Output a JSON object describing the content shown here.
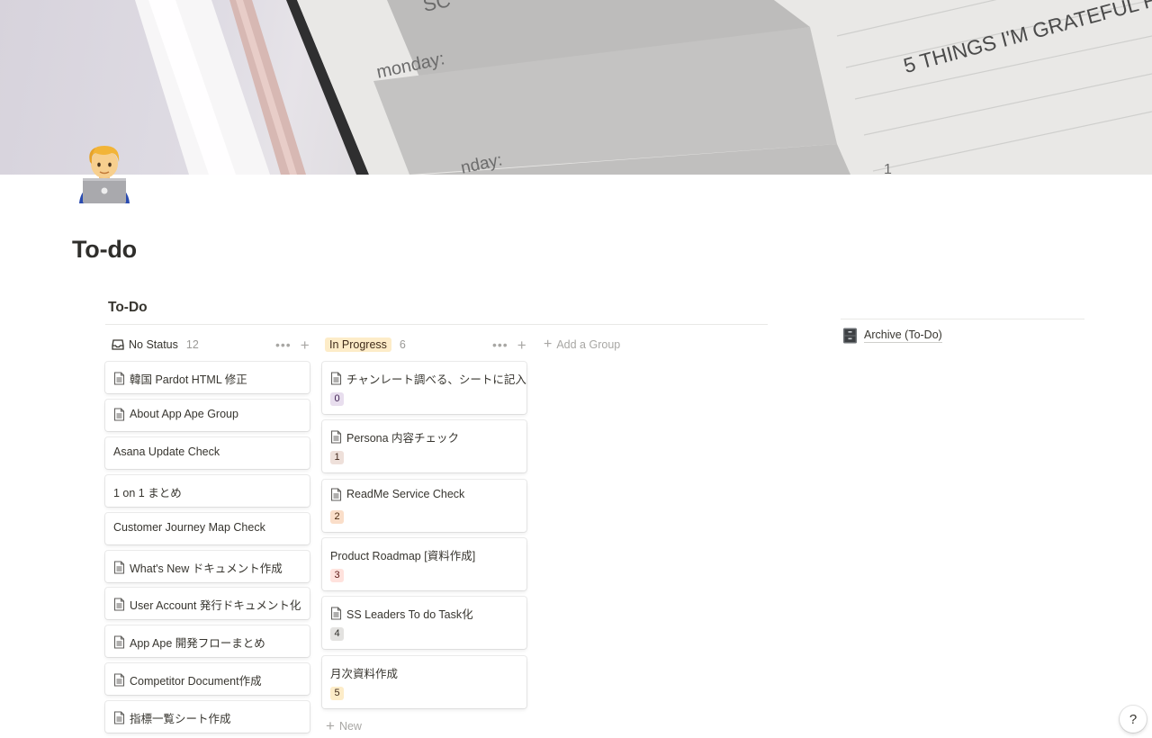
{
  "cover": {
    "texts": [
      "SC",
      "monday:",
      "5 THINGS I'M GRATEFUL F",
      "nday:",
      "1"
    ]
  },
  "page": {
    "icon": "technologist-emoji",
    "title": "To-do"
  },
  "database": {
    "title": "To-Do",
    "add_group_label": "Add a Group",
    "new_label": "New",
    "groups": [
      {
        "label": "No Status",
        "count": "12",
        "cards": [
          {
            "title": "韓国 Pardot HTML 修正",
            "icon": "page-icon"
          },
          {
            "title": "About App Ape Group",
            "icon": "page-icon"
          },
          {
            "title": "Asana Update Check",
            "icon": ""
          },
          {
            "title": "1 on 1 まとめ",
            "icon": ""
          },
          {
            "title": "Customer Journey Map Check",
            "icon": ""
          },
          {
            "title": "What's New ドキュメント作成",
            "icon": "page-icon"
          },
          {
            "title": "User Account 発行ドキュメント化",
            "icon": "page-icon"
          },
          {
            "title": "App Ape 開発フローまとめ",
            "icon": "page-icon"
          },
          {
            "title": "Competitor Document作成",
            "icon": "page-icon"
          },
          {
            "title": "指標一覧シート作成",
            "icon": "page-icon"
          }
        ]
      },
      {
        "label": "In Progress",
        "count": "6",
        "color": "#fdecc8",
        "cards": [
          {
            "title": "チャンレート調べる、シートに記入",
            "icon": "page-icon",
            "tag": "0",
            "tag_bg": "#e8deee",
            "tag_fg": "#412454"
          },
          {
            "title": "Persona 内容チェック",
            "icon": "page-icon",
            "tag": "1",
            "tag_bg": "#eee0da",
            "tag_fg": "#442a1e"
          },
          {
            "title": "ReadMe Service Check",
            "icon": "page-icon",
            "tag": "2",
            "tag_bg": "#fadec9",
            "tag_fg": "#49290e"
          },
          {
            "title": "Product Roadmap [資料作成]",
            "icon": "",
            "tag": "3",
            "tag_bg": "#ffe2dd",
            "tag_fg": "#5d1715"
          },
          {
            "title": "SS Leaders To do Task化",
            "icon": "page-icon",
            "tag": "4",
            "tag_bg": "#e3e2e0",
            "tag_fg": "#32302c"
          },
          {
            "title": "月次資料作成",
            "icon": "",
            "tag": "5",
            "tag_bg": "#fdecc8",
            "tag_fg": "#402c1b"
          }
        ]
      }
    ]
  },
  "sidebar": {
    "archive_label": "Archive (To-Do)",
    "archive_icon": "file-cabinet-icon"
  },
  "help_label": "?"
}
